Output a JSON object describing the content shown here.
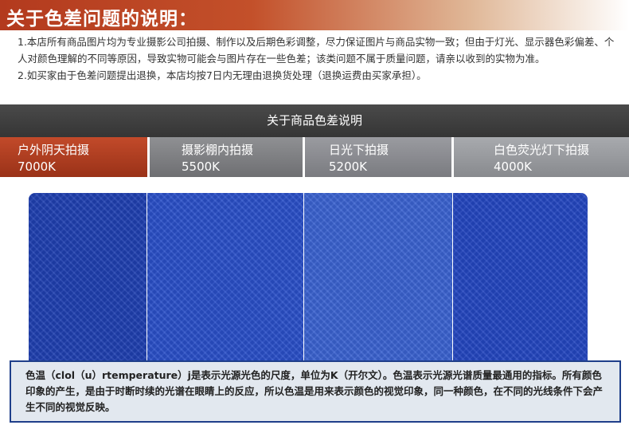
{
  "title": "关于色差问题的说明：",
  "notes": [
    "1.本店所有商品图片均为专业摄影公司拍摄、制作以及后期色彩调整，尽力保证图片与商品实物一致；但由于灯光、显示器色彩偏差、个人对颜色理解的不同等原因，导致实物可能会与图片存在一些色差；该类问题不属于质量问题，请亲以收到的实物为准。",
    "2.如买家由于色差问题提出退换，本店均按7日内无理由退换货处理（退换运费由买家承担）。"
  ],
  "header": "关于商品色差说明",
  "conditions": [
    {
      "label": "户外阴天拍摄",
      "temp": "7000K",
      "color": "#b03c20"
    },
    {
      "label": "摄影棚内拍摄",
      "temp": "5500K",
      "color": "#7f8083"
    },
    {
      "label": "日光下拍摄",
      "temp": "5200K",
      "color": "#8a8b90"
    },
    {
      "label": "白色荧光灯下拍摄",
      "temp": "4000K",
      "color": "#989a9e"
    }
  ],
  "swatch_colors": [
    "#1f3fb0",
    "#2a4fc8",
    "#3a62d0",
    "#2346bf"
  ],
  "info": "色温（clol（u）rtemperature）j是表示光源光色的尺度，单位为K（开尔文）。色温表示光源光谱质量最通用的指标。所有颜色印象的产生，是由于时断时续的光谱在眼睛上的反应，所以色温是用来表示颜色的视觉印象，同一种颜色，在不同的光线条件下会产生不同的视觉反映。"
}
